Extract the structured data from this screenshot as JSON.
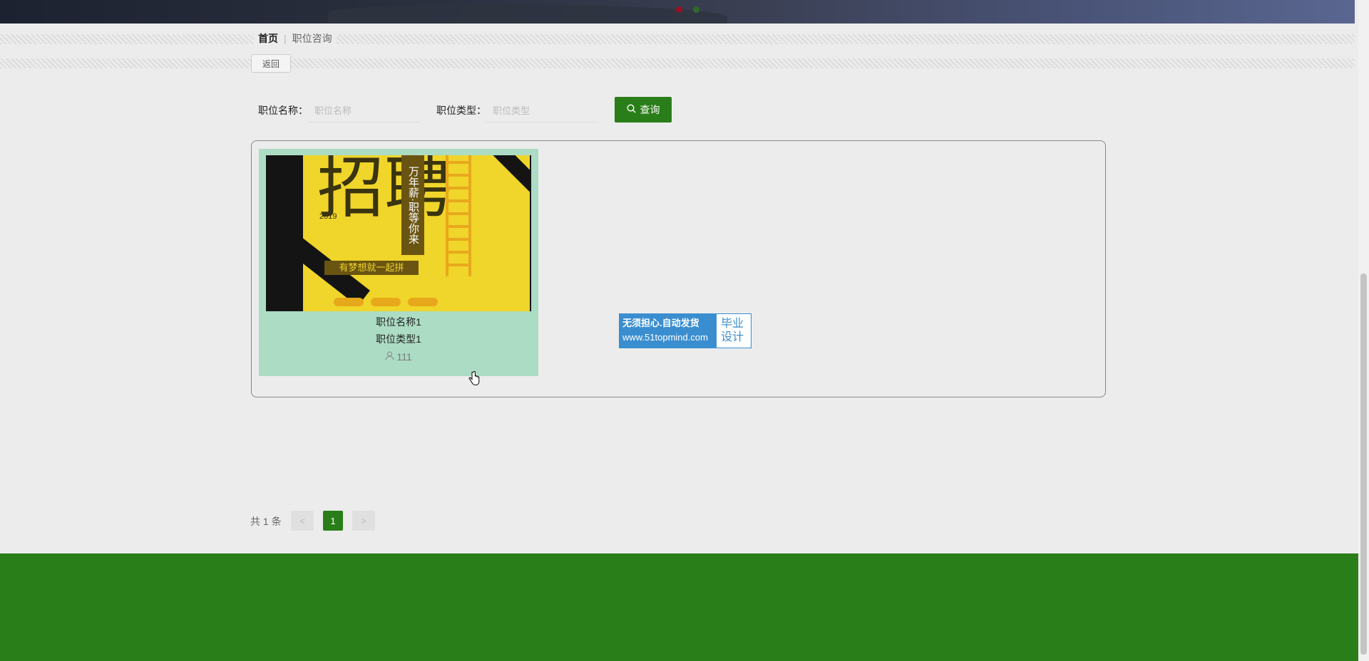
{
  "breadcrumb": {
    "home": "首页",
    "separator": "|",
    "current": "职位咨询"
  },
  "back_button": {
    "label": "返回"
  },
  "search": {
    "name_label": "职位名称：",
    "name_placeholder": "职位名称",
    "type_label": "职位类型：",
    "type_placeholder": "职位类型",
    "query_label": "查询",
    "query_icon": "search-icon"
  },
  "items": [
    {
      "poster_big_text": "招聘",
      "poster_year": "2019",
      "poster_vertical": "万年薪·职等你来",
      "poster_slogan": "有梦想就一起拼",
      "name": "职位名称1",
      "type": "职位类型1",
      "count": "111",
      "count_icon": "user-icon"
    }
  ],
  "promo": {
    "line1": "无须担心.自动发货",
    "line2": "www.51topmind.com",
    "line3": "毕业",
    "line4": "设计"
  },
  "pagination": {
    "total": "共 1 条",
    "prev": "<",
    "current_page": "1",
    "next": ">"
  },
  "colors": {
    "primary": "#2a7e19",
    "card_bg": "#acdcc4",
    "page_bg": "#ececec"
  }
}
